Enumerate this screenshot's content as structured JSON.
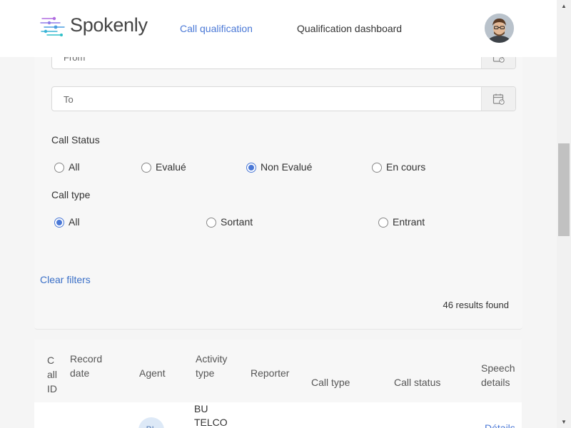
{
  "header": {
    "brand": "Spokenly",
    "nav": [
      "Call qualification",
      "Qualification dashboard"
    ],
    "active_nav": "Call qualification"
  },
  "filters": {
    "from_placeholder": "From",
    "to_placeholder": "To",
    "call_status": {
      "label": "Call Status",
      "options": [
        "All",
        "Evalué",
        "Non Evalué",
        "En cours"
      ],
      "selected": "Non Evalué"
    },
    "call_type": {
      "label": "Call type",
      "options": [
        "All",
        "Sortant",
        "Entrant"
      ],
      "selected": "All"
    },
    "clear_label": "Clear filters",
    "results_text": "46 results found"
  },
  "table": {
    "columns": [
      "Call ID",
      "Record date",
      "Agent",
      "Activity type",
      "Reporter",
      "Call type",
      "Call status",
      "Speech details"
    ],
    "rows": [
      {
        "agent_initials": "BL",
        "activity_type": "BU TELCO",
        "details_link": "Détails"
      }
    ]
  },
  "colors": {
    "accent": "#4a78d6",
    "link": "#3a6fc7",
    "background": "#f5f5f5"
  }
}
